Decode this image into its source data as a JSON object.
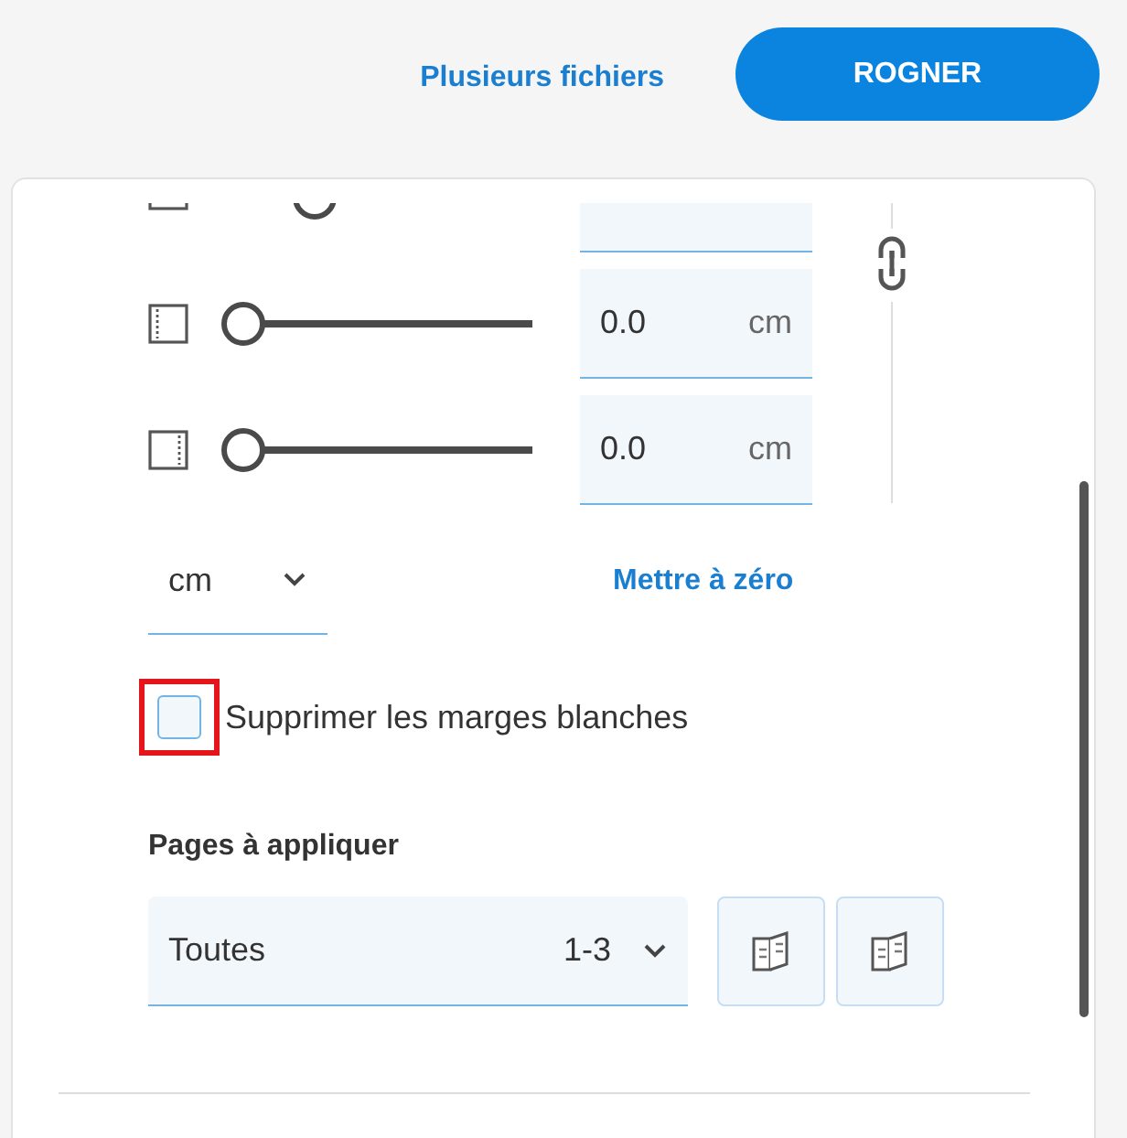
{
  "header": {
    "link": "Plusieurs fichiers",
    "button": "ROGNER"
  },
  "margins": [
    {
      "kind": "bottom",
      "level": 0.27
    },
    {
      "kind": "left",
      "level": 0,
      "value": "0.0",
      "unit": "cm"
    },
    {
      "kind": "right",
      "level": 0,
      "value": "0.0",
      "unit": "cm"
    }
  ],
  "unit_select": {
    "value": "cm"
  },
  "reset_link": "Mettre à zéro",
  "remove_white_margins": {
    "label": "Supprimer les marges blanches",
    "checked": false,
    "highlighted": true
  },
  "pages": {
    "label": "Pages à appliquer",
    "value": "Toutes",
    "range": "1-3"
  }
}
